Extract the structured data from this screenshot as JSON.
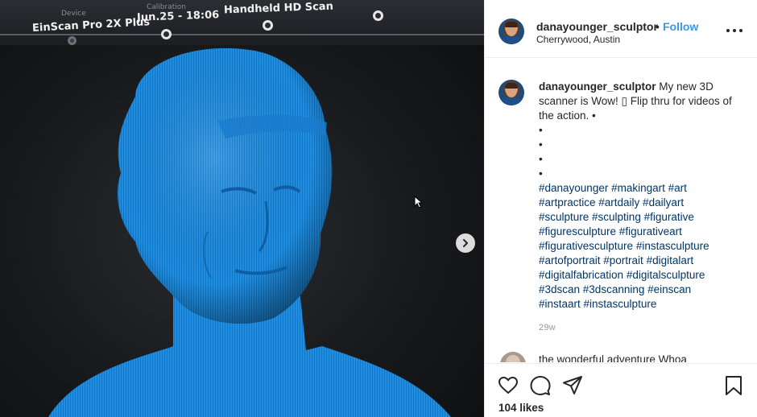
{
  "media": {
    "overlay": {
      "device_caption": "Device",
      "device": "EinScan Pro 2X Plus",
      "calibration_caption": "Calibration",
      "date": "Jun.25 - 18:06",
      "mode": "Handheld HD Scan"
    },
    "scan_color": "#1e8fe0",
    "next_icon": "chevron-right-icon"
  },
  "post": {
    "author": {
      "username": "danayounger_sculptor",
      "separator": "•",
      "follow_label": "Follow",
      "location": "Cherrywood, Austin"
    },
    "caption": {
      "username": "danayounger_sculptor",
      "text": "My new 3D scanner is Wow! ▯ Flip thru for videos of the action. •",
      "bullets": [
        "•",
        "•",
        "•",
        "•"
      ],
      "hashtag_lines": [
        "#danayounger #makingart #art",
        "#artpractice #artdaily #dailyart",
        "#sculpture #sculpting #figurative",
        "#figuresculpture #figurativeart",
        "#figurativesculpture #instasculpture",
        "#artofportrait #portrait #digitalart",
        "#digitalfabrication #digitalsculpture",
        "#3dscan #3dscanning #einscan",
        "#instaart #instasculpture"
      ],
      "age": "29w"
    },
    "next_comment": {
      "text": "the wonderful adventure Whoa"
    },
    "actions": {
      "like_icon": "heart-icon",
      "comment_icon": "comment-icon",
      "share_icon": "share-icon",
      "save_icon": "bookmark-icon",
      "likes": "104 likes"
    },
    "colors": {
      "link": "#3897f0",
      "hashtag": "#003569",
      "muted": "#999999"
    }
  }
}
